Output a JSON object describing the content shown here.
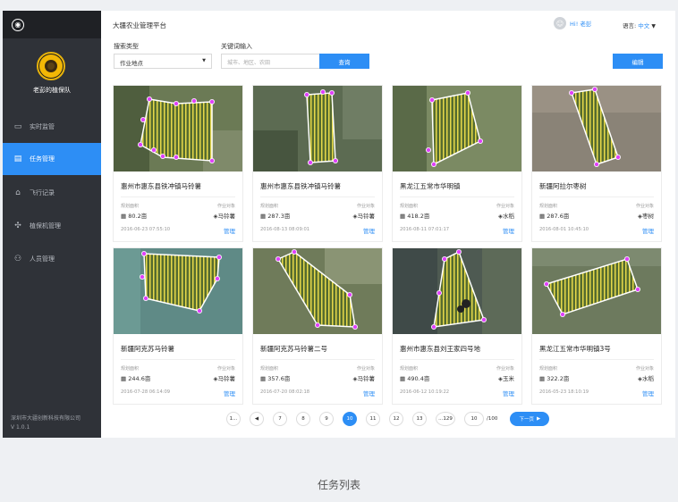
{
  "app": {
    "title": "大疆农业管理平台"
  },
  "sidebar": {
    "team_name": "老彭的植保队",
    "items": [
      {
        "label": "实时监管",
        "icon": "monitor-icon"
      },
      {
        "label": "任务管理",
        "icon": "task-icon",
        "active": true
      },
      {
        "label": "飞行记录",
        "icon": "flight-record-icon"
      },
      {
        "label": "植保机管理",
        "icon": "drone-icon"
      },
      {
        "label": "人员管理",
        "icon": "people-icon"
      }
    ],
    "company": "深圳市大疆创新科技有限公司",
    "version": "V 1.0.1"
  },
  "header": {
    "greeting": "Hi! 老彭",
    "lang_label": "语言:",
    "lang_value": "中文"
  },
  "search": {
    "type_label": "搜索类型",
    "type_value": "作业地点",
    "keyword_label": "关键词输入",
    "keyword_placeholder": "城市、地区、农田",
    "query_button": "查询",
    "edit_button": "编辑"
  },
  "card_labels": {
    "area_key": "规划面积",
    "crop_key": "作业对象",
    "manage": "管理"
  },
  "cards": [
    {
      "name": "惠州市惠东县铁冲镇马铃薯",
      "area": "80.2亩",
      "crop": "马铃薯",
      "date": "2016-06-23 07:55:10"
    },
    {
      "name": "惠州市惠东县铁冲镇马铃薯",
      "area": "287.3亩",
      "crop": "马铃薯",
      "date": "2016-08-13 08:09:01"
    },
    {
      "name": "黑龙江五常市华明镇",
      "area": "418.2亩",
      "crop": "水稻",
      "date": "2016-08-11 07:01:17"
    },
    {
      "name": "新疆阿拉尔枣树",
      "area": "287.6亩",
      "crop": "枣树",
      "date": "2016-08-01 10:45:10"
    },
    {
      "name": "新疆阿克苏马铃薯",
      "area": "244.6亩",
      "crop": "马铃薯",
      "date": "2016-07-28 06:14:09"
    },
    {
      "name": "新疆阿克苏马铃薯二号",
      "area": "357.6亩",
      "crop": "马铃薯",
      "date": "2016-07-20 08:02:18"
    },
    {
      "name": "惠州市惠东县刘王家四号地",
      "area": "490.4亩",
      "crop": "玉米",
      "date": "2016-06-12 10:19:22"
    },
    {
      "name": "黑龙江五常市华明镇3号",
      "area": "322.2亩",
      "crop": "水稻",
      "date": "2016-05-23 18:10:19"
    }
  ],
  "pagination": {
    "first": "1...",
    "pages": [
      "7",
      "8",
      "9",
      "10",
      "11",
      "12",
      "13",
      "...129"
    ],
    "current": "10",
    "goto_value": "10",
    "total": "/100",
    "next": "下一页"
  },
  "caption": "任务列表",
  "colors": {
    "accent": "#2d8ef5",
    "sidebar": "#2f3238",
    "vertex": "#e040fb",
    "stripe": "#e6d84a"
  }
}
